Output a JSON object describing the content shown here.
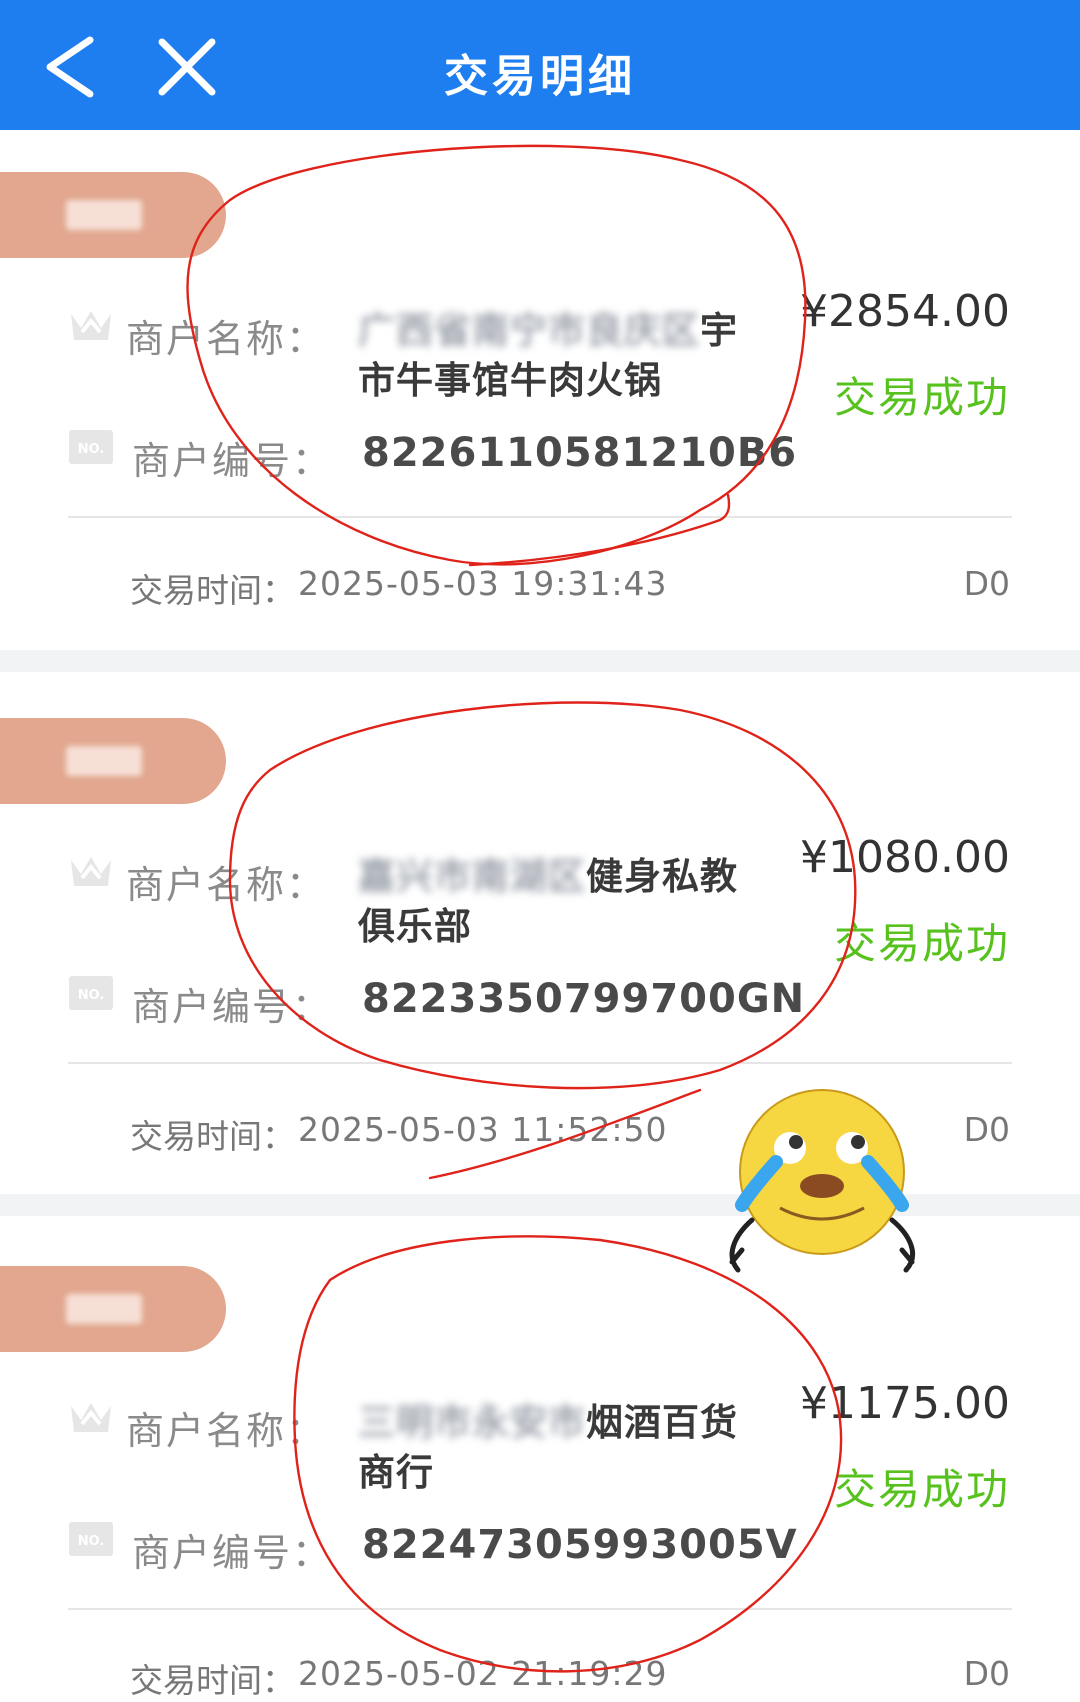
{
  "header": {
    "title": "交易明细",
    "back_icon": "chevron-left-icon",
    "close_icon": "close-icon"
  },
  "labels": {
    "merchant_name": "商户名称：",
    "merchant_no": "商户编号：",
    "time": "交易时间："
  },
  "transactions": [
    {
      "name_line1_blurred": "广西省南宁市良庆区",
      "name_line1_tail": "宇",
      "name_line2": "市牛事馆牛肉火锅",
      "merchant_no": "8226110581210B6",
      "amount": "¥2854.00",
      "status": "交易成功",
      "time": "2025-05-03 19:31:43",
      "settle": "D0"
    },
    {
      "name_line1_blurred": "嘉兴市南湖区",
      "name_line1_tail": "健身私教",
      "name_line2": "俱乐部",
      "merchant_no": "8223350799700GN",
      "amount": "¥1080.00",
      "status": "交易成功",
      "time": "2025-05-03 11:52:50",
      "settle": "D0"
    },
    {
      "name_line1_blurred": "三明市永安市",
      "name_line1_tail": "烟酒百货",
      "name_line2": "商行",
      "merchant_no": "82247305993005V",
      "amount": "¥1175.00",
      "status": "交易成功",
      "time": "2025-05-02 21:19:29",
      "settle": "D0"
    }
  ],
  "colors": {
    "header_bg": "#1e7ef0",
    "status_success": "#57c21e",
    "tag_bg": "#e2a78e",
    "annotation": "#e0231a"
  },
  "icons": {
    "name_icon": "crown-icon",
    "number_icon": "no-badge-icon",
    "sticker": "crying-laughing-emoji-sticker"
  }
}
